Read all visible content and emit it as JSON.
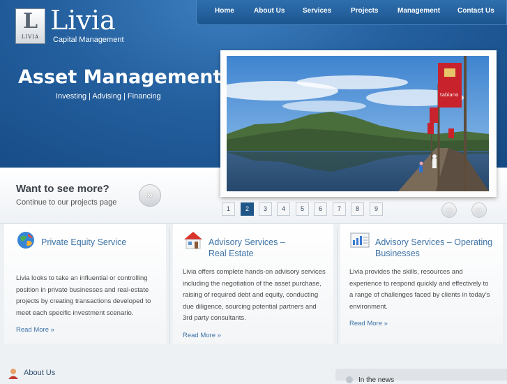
{
  "logo": {
    "badge_letter": "L",
    "badge_text": "LIVIA",
    "name": "Livia",
    "subtitle": "Capital Management"
  },
  "nav": {
    "items": [
      "Home",
      "About Us",
      "Services",
      "Projects",
      "Management",
      "Contact Us"
    ]
  },
  "hero": {
    "title": "Asset Management",
    "tagline": "Investing | Advising | Financing"
  },
  "slide": {
    "sign_text": "tabiano"
  },
  "projects_strip": {
    "heading": "Want to see more?",
    "subtext": "Continue to our projects page",
    "button_glyph": "»"
  },
  "slider": {
    "pages": [
      "1",
      "2",
      "3",
      "4",
      "5",
      "6",
      "7",
      "8",
      "9"
    ],
    "active_page": "2",
    "prev_glyph": "«",
    "next_glyph": "»"
  },
  "services": [
    {
      "title": "Private Equity Service",
      "icon": "globe-icon",
      "text": [
        "Livia looks to take an influential or controlling",
        "position in private businesses and real-estate",
        "projects by creating transactions developed to",
        "meet each specific investment scenario."
      ],
      "link": "Read More »"
    },
    {
      "title_line1": "Advisory Services –",
      "title_line2": "Real Estate",
      "icon": "house-icon",
      "text": [
        "Livia offers complete hands-on advisory services",
        "including the negotiation of the asset purchase,",
        "raising of required debt and equity, conducting",
        "due diligence, sourcing potential partners and",
        "3rd party consultants."
      ],
      "link": "Read More »"
    },
    {
      "title_line1": "Advisory Services – Operating",
      "title_line2": "Businesses",
      "icon": "document-chart-icon",
      "text": [
        "Livia provides the skills, resources and",
        "experience to respond quickly and effectively to",
        "a range of challenges faced by clients in today's",
        "environment."
      ],
      "link": "Read More »"
    }
  ],
  "footer": {
    "about_label": "About Us",
    "about_icon": "person-icon",
    "news_label": "In the news"
  },
  "colors": {
    "nav_bg": "#1f5a94",
    "accent": "#3d73a6",
    "active_page": "#1f5688"
  }
}
